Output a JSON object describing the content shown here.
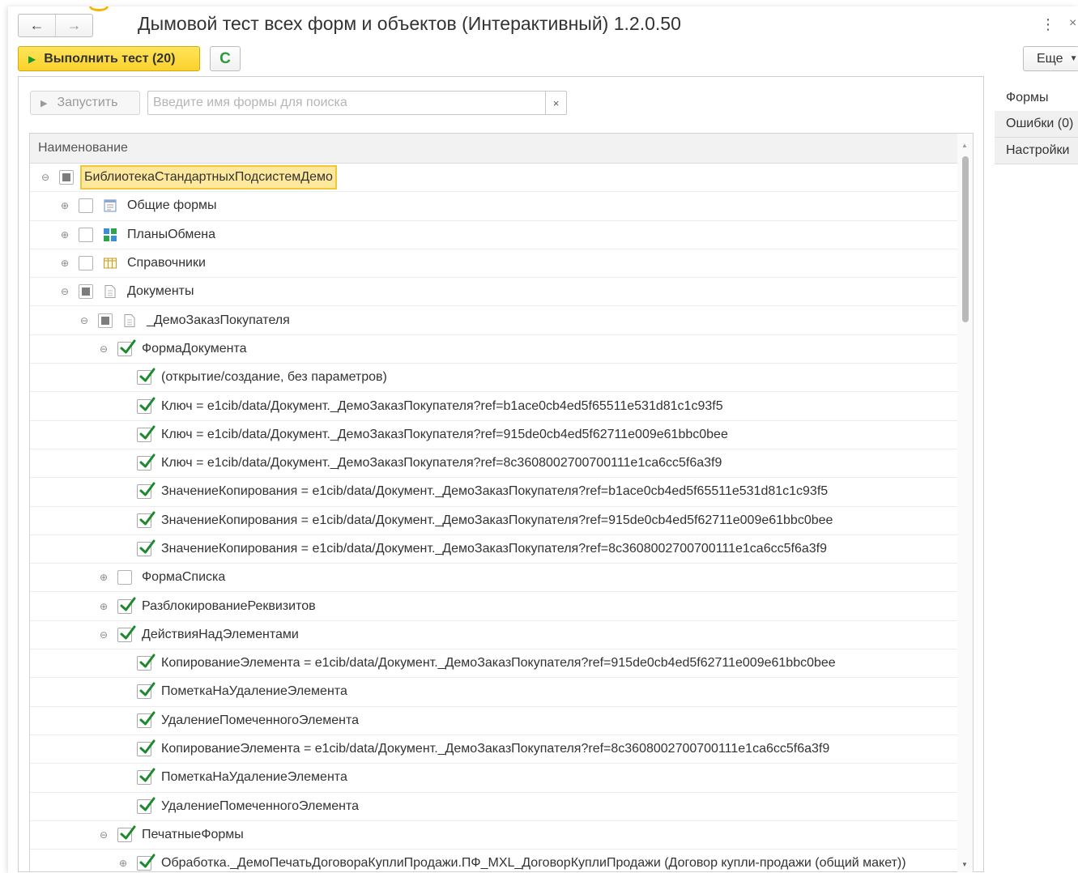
{
  "window": {
    "title": "Дымовой тест всех форм и объектов (Интерактивный) 1.2.0.50"
  },
  "nav": {
    "back_icon": "←",
    "forward_icon": "→"
  },
  "header_icons": {
    "menu": "⋮",
    "close": "×"
  },
  "toolbar": {
    "run_label": "Выполнить тест (20)",
    "refresh_icon": "C",
    "more_label": "Еще"
  },
  "panel": {
    "start_label": "Запустить",
    "search_placeholder": "Введите имя формы для поиска",
    "search_clear": "×",
    "column_header": "Наименование"
  },
  "tree": [
    {
      "indent": 0,
      "expander": "minus",
      "check": "partial",
      "icon": "",
      "label": "БиблиотекаСтандартныхПодсистемДемо",
      "selected": true
    },
    {
      "indent": 1,
      "expander": "plus",
      "check": "unchecked",
      "icon": "form-icon",
      "label": "Общие формы"
    },
    {
      "indent": 1,
      "expander": "plus",
      "check": "unchecked",
      "icon": "exchange-plan-icon",
      "label": "ПланыОбмена"
    },
    {
      "indent": 1,
      "expander": "plus",
      "check": "unchecked",
      "icon": "catalog-icon",
      "label": "Справочники"
    },
    {
      "indent": 1,
      "expander": "minus",
      "check": "partial",
      "icon": "document-icon",
      "label": "Документы"
    },
    {
      "indent": 2,
      "expander": "minus",
      "check": "partial",
      "icon": "document-icon",
      "label": "_ДемоЗаказПокупателя"
    },
    {
      "indent": 3,
      "expander": "minus",
      "check": "checked",
      "icon": "",
      "label": "ФормаДокумента"
    },
    {
      "indent": 4,
      "expander": "none",
      "check": "checked",
      "icon": "",
      "label": "(открытие/создание, без параметров)"
    },
    {
      "indent": 4,
      "expander": "none",
      "check": "checked",
      "icon": "",
      "label": "Ключ = e1cib/data/Документ._ДемоЗаказПокупателя?ref=b1ace0cb4ed5f65511e531d81c1c93f5"
    },
    {
      "indent": 4,
      "expander": "none",
      "check": "checked",
      "icon": "",
      "label": "Ключ = e1cib/data/Документ._ДемоЗаказПокупателя?ref=915de0cb4ed5f62711e009e61bbc0bee"
    },
    {
      "indent": 4,
      "expander": "none",
      "check": "checked",
      "icon": "",
      "label": "Ключ = e1cib/data/Документ._ДемоЗаказПокупателя?ref=8c3608002700700111e1ca6cc5f6a3f9"
    },
    {
      "indent": 4,
      "expander": "none",
      "check": "checked",
      "icon": "",
      "label": "ЗначениеКопирования = e1cib/data/Документ._ДемоЗаказПокупателя?ref=b1ace0cb4ed5f65511e531d81c1c93f5"
    },
    {
      "indent": 4,
      "expander": "none",
      "check": "checked",
      "icon": "",
      "label": "ЗначениеКопирования = e1cib/data/Документ._ДемоЗаказПокупателя?ref=915de0cb4ed5f62711e009e61bbc0bee"
    },
    {
      "indent": 4,
      "expander": "none",
      "check": "checked",
      "icon": "",
      "label": "ЗначениеКопирования = e1cib/data/Документ._ДемоЗаказПокупателя?ref=8c3608002700700111e1ca6cc5f6a3f9"
    },
    {
      "indent": 3,
      "expander": "plus",
      "check": "unchecked",
      "icon": "",
      "label": "ФормаСписка"
    },
    {
      "indent": 3,
      "expander": "plus",
      "check": "checked",
      "icon": "",
      "label": "РазблокированиеРеквизитов"
    },
    {
      "indent": 3,
      "expander": "minus",
      "check": "checked",
      "icon": "",
      "label": "ДействияНадЭлементами"
    },
    {
      "indent": 4,
      "expander": "none",
      "check": "checked",
      "icon": "",
      "label": "КопированиеЭлемента = e1cib/data/Документ._ДемоЗаказПокупателя?ref=915de0cb4ed5f62711e009e61bbc0bee"
    },
    {
      "indent": 4,
      "expander": "none",
      "check": "checked",
      "icon": "",
      "label": "ПометкаНаУдалениеЭлемента"
    },
    {
      "indent": 4,
      "expander": "none",
      "check": "checked",
      "icon": "",
      "label": "УдалениеПомеченногоЭлемента"
    },
    {
      "indent": 4,
      "expander": "none",
      "check": "checked",
      "icon": "",
      "label": "КопированиеЭлемента = e1cib/data/Документ._ДемоЗаказПокупателя?ref=8c3608002700700111e1ca6cc5f6a3f9"
    },
    {
      "indent": 4,
      "expander": "none",
      "check": "checked",
      "icon": "",
      "label": "ПометкаНаУдалениеЭлемента"
    },
    {
      "indent": 4,
      "expander": "none",
      "check": "checked",
      "icon": "",
      "label": "УдалениеПомеченногоЭлемента"
    },
    {
      "indent": 3,
      "expander": "minus",
      "check": "checked",
      "icon": "",
      "label": "ПечатныеФормы"
    },
    {
      "indent": 4,
      "expander": "plus",
      "check": "checked",
      "icon": "",
      "label": "Обработка._ДемоПечатьДоговораКуплиПродажи.ПФ_MXL_ДоговорКуплиПродажи (Договор купли-продажи (общий макет))"
    }
  ],
  "side_tabs": [
    {
      "label": "Формы",
      "active": true
    },
    {
      "label": "Ошибки (0)",
      "active": false
    },
    {
      "label": "Настройки",
      "active": false
    }
  ]
}
